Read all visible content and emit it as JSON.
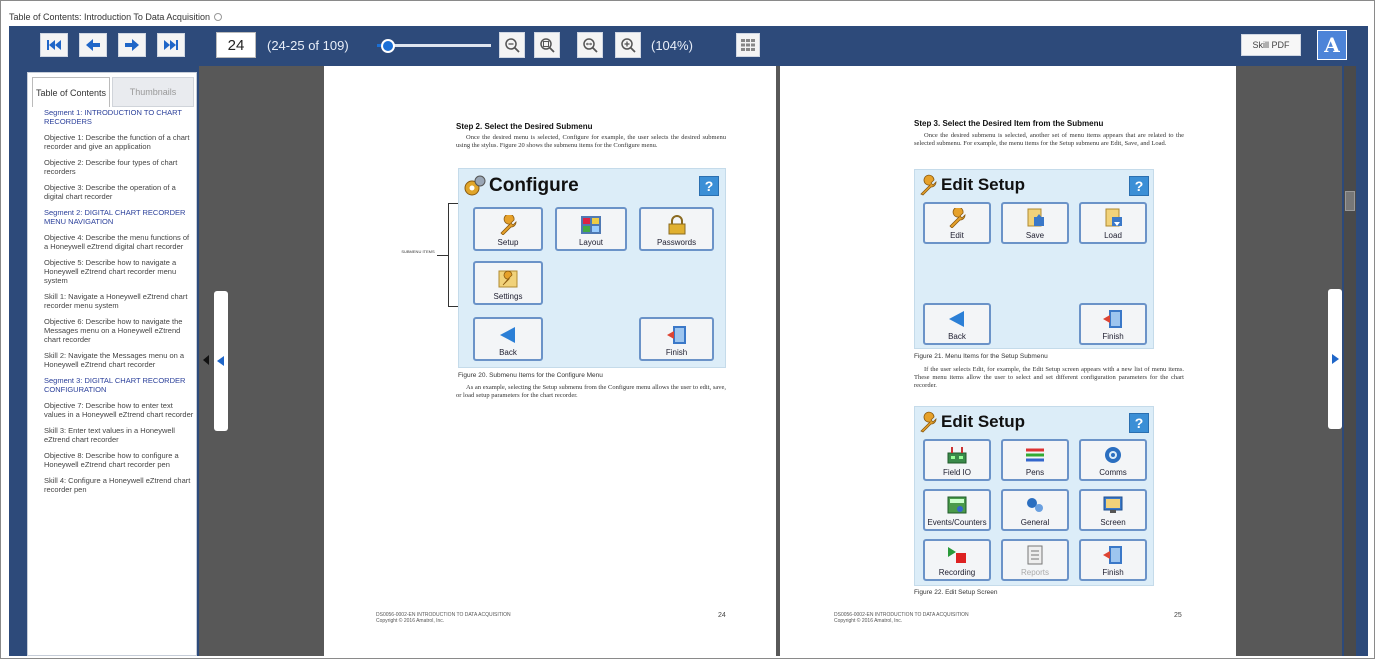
{
  "window": {
    "title": "Table of Contents: Introduction To Data Acquisition"
  },
  "toolbar": {
    "page_number": "24",
    "page_range": "(24-25 of 109)",
    "zoom_percent": "(104%)",
    "zoom_level": 0.1,
    "skill_pdf_label": "Skill PDF",
    "accessibility_label": "A",
    "icons": [
      "first-page-icon",
      "previous-page-icon",
      "next-page-icon",
      "last-page-icon",
      "zoom-out-icon",
      "fit-page-icon",
      "fit-width-icon",
      "zoom-in-icon",
      "thumbnails-grid-icon"
    ]
  },
  "sidebar": {
    "tabs": [
      {
        "label": "Table of Contents"
      },
      {
        "label": "Thumbnails"
      }
    ],
    "items": [
      {
        "type": "segment",
        "text": "Segment 1: INTRODUCTION TO CHART RECORDERS"
      },
      {
        "type": "item",
        "text": "Objective 1: Describe the function of a chart recorder and give an application"
      },
      {
        "type": "item",
        "text": "Objective 2: Describe four types of chart recorders"
      },
      {
        "type": "item",
        "text": "Objective 3: Describe the operation of a digital chart recorder"
      },
      {
        "type": "segment",
        "text": "Segment 2: DIGITAL CHART RECORDER MENU NAVIGATION"
      },
      {
        "type": "item",
        "text": "Objective 4: Describe the menu functions of a Honeywell eZtrend digital chart recorder"
      },
      {
        "type": "item",
        "text": "Objective 5: Describe how to navigate a Honeywell eZtrend chart recorder menu system"
      },
      {
        "type": "item",
        "text": "Skill 1: Navigate a Honeywell eZtrend chart recorder menu system"
      },
      {
        "type": "item",
        "text": "Objective 6: Describe how to navigate the Messages menu on a Honeywell eZtrend chart recorder"
      },
      {
        "type": "item",
        "text": "Skill 2: Navigate the Messages menu on a Honeywell eZtrend chart recorder"
      },
      {
        "type": "segment",
        "text": "Segment 3: DIGITAL CHART RECORDER CONFIGURATION"
      },
      {
        "type": "item",
        "text": "Objective 7: Describe how to enter text values in a Honeywell eZtrend chart recorder"
      },
      {
        "type": "item",
        "text": "Skill 3: Enter text values in a Honeywell eZtrend chart recorder"
      },
      {
        "type": "item",
        "text": "Objective 8: Describe how to configure a Honeywell eZtrend chart recorder pen"
      },
      {
        "type": "item",
        "text": "Skill 4: Configure a Honeywell eZtrend chart recorder pen"
      }
    ]
  },
  "page_left": {
    "heading": "Step 2. Select the Desired Submenu",
    "body1": "Once the desired menu is selected, Configure for example, the user selects the desired submenu using the stylus. Figure 20 shows the submenu items for the Configure menu.",
    "callout": "SUBMENU ITEMS",
    "screen": {
      "title": "Configure",
      "help": "?",
      "tiles": [
        "Setup",
        "Layout",
        "Passwords",
        "Settings",
        "Back",
        "Finish"
      ]
    },
    "caption": "Figure 20. Submenu Items for the Configure Menu",
    "body2": "As an example, selecting the Setup submenu from the Configure menu allows the user to edit, save, or load setup parameters for the chart recorder.",
    "footer_line1": "DS0056-0002-EN  INTRODUCTION TO DATA ACQUISITION",
    "footer_line2": "Copyright © 2016 Amatrol, Inc.",
    "page_no": "24"
  },
  "page_right": {
    "heading": "Step 3. Select the Desired Item from the Submenu",
    "body1": "Once the desired submenu is selected, another set of menu items appears that are related to the selected submenu. For example, the menu items for the Setup submenu are Edit, Save, and Load.",
    "screen1": {
      "title": "Edit Setup",
      "help": "?",
      "tiles": [
        "Edit",
        "Save",
        "Load",
        "Back",
        "Finish"
      ]
    },
    "caption1": "Figure 21. Menu Items for the Setup Submenu",
    "body2": "If the user selects Edit, for example, the Edit Setup screen appears with a new list of menu items. These menu items allow the user to select and set different configuration parameters for the chart recorder.",
    "screen2": {
      "title": "Edit Setup",
      "help": "?",
      "tiles": [
        "Field IO",
        "Pens",
        "Comms",
        "Events/Counters",
        "General",
        "Screen",
        "Recording",
        "Reports",
        "Finish"
      ]
    },
    "caption2": "Figure 22. Edit Setup Screen",
    "footer_line1": "DS0056-0002-EN  INTRODUCTION TO DATA ACQUISITION",
    "footer_line2": "Copyright © 2016 Amatrol, Inc.",
    "page_no": "25"
  },
  "colors": {
    "toolbar_bg": "#2d4a7a",
    "accent_blue": "#1a6fd6",
    "screen_bg": "#dcedf8",
    "tile_border": "#6b93c8",
    "segment_link": "#2a3f9a"
  }
}
